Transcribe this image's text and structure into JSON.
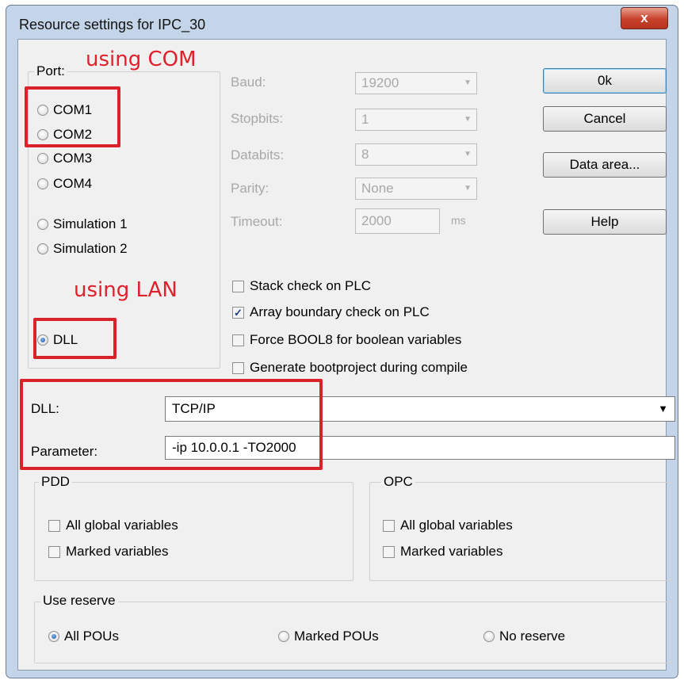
{
  "window": {
    "title": "Resource settings for IPC_30",
    "close_label": "x"
  },
  "annotations": {
    "com": "using COM",
    "lan": "using LAN"
  },
  "port": {
    "label": "Port:",
    "options": [
      "COM1",
      "COM2",
      "COM3",
      "COM4",
      "Simulation 1",
      "Simulation 2",
      "DLL"
    ],
    "selected": "DLL"
  },
  "serial": {
    "baud_label": "Baud:",
    "baud_value": "19200",
    "stopbits_label": "Stopbits:",
    "stopbits_value": "1",
    "databits_label": "Databits:",
    "databits_value": "8",
    "parity_label": "Parity:",
    "parity_value": "None",
    "timeout_label": "Timeout:",
    "timeout_value": "2000",
    "timeout_unit": "ms"
  },
  "buttons": {
    "ok": "0k",
    "cancel": "Cancel",
    "data_area": "Data area...",
    "help": "Help"
  },
  "options": [
    {
      "label": "Stack check on PLC",
      "checked": false
    },
    {
      "label": "Array boundary check on PLC",
      "checked": true
    },
    {
      "label": "Force BOOL8 for boolean variables",
      "checked": false
    },
    {
      "label": "Generate bootproject during compile",
      "checked": false
    }
  ],
  "dll": {
    "label": "DLL:",
    "value": "TCP/IP"
  },
  "parameter": {
    "label": "Parameter:",
    "value": "-ip 10.0.0.1 -TO2000"
  },
  "pdd": {
    "title": "PDD",
    "all_global": "All global variables",
    "marked": "Marked variables"
  },
  "opc": {
    "title": "OPC",
    "all_global": "All global variables",
    "marked": "Marked variables"
  },
  "reserve": {
    "title": "Use reserve",
    "all": "All POUs",
    "marked": "Marked POUs",
    "none": "No reserve",
    "selected": "All POUs"
  },
  "colors": {
    "annotation": "#d9222a",
    "client_bg": "#f0f0f0",
    "frame": "#c4d5ea"
  }
}
